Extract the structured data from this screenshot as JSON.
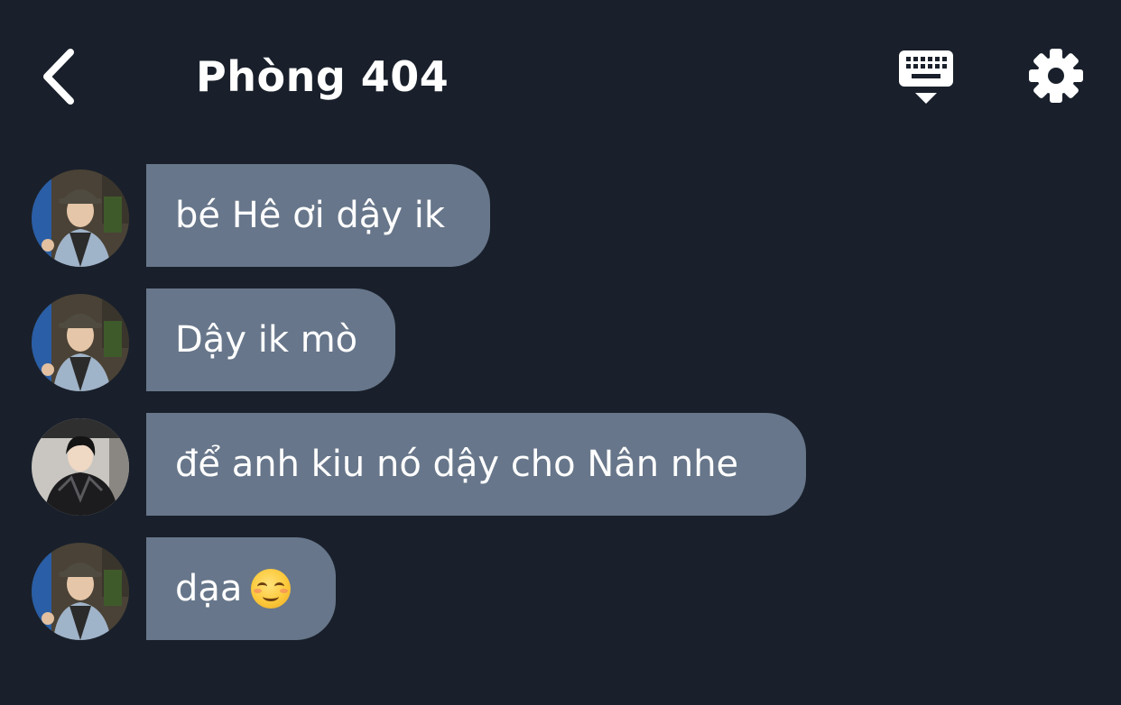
{
  "header": {
    "title": "Phòng 404",
    "back_icon": "chevron-left-icon",
    "keyboard_icon": "keyboard-icon",
    "settings_icon": "gear-icon"
  },
  "colors": {
    "background": "#19202b",
    "bubble": "#67768a",
    "text": "#ffffff"
  },
  "messages": [
    {
      "avatar": "avatar-bucket-hat",
      "text": "bé Hê ơi dậy ik"
    },
    {
      "avatar": "avatar-bucket-hat",
      "text": "Dậy ik mò"
    },
    {
      "avatar": "avatar-leather-jacket",
      "text": "để anh kiu nó dậy cho Nân nhe"
    },
    {
      "avatar": "avatar-bucket-hat",
      "text": "dạa",
      "emoji": "smiling-face-icon"
    }
  ]
}
